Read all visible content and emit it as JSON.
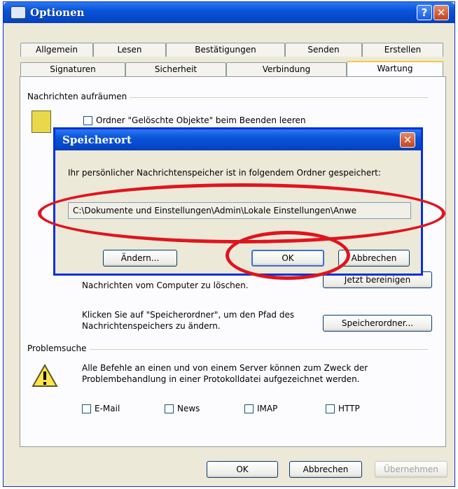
{
  "window": {
    "title": "Optionen",
    "help_glyph": "?",
    "close_glyph": "✕"
  },
  "tabs_row1": [
    "Allgemein",
    "Lesen",
    "Bestätigungen",
    "Senden",
    "Erstellen"
  ],
  "tabs_row2": [
    "Signaturen",
    "Sicherheit",
    "Verbindung",
    "Wartung"
  ],
  "active_tab": "Wartung",
  "cleanup": {
    "group_label": "Nachrichten aufräumen",
    "checkbox_empty_deleted": "Ordner \"Gelöschte Objekte\" beim Beenden leeren",
    "delete_text": "Nachrichten vom Computer zu löschen.",
    "delete_button": "Jetzt bereinigen",
    "store_text": "Klicken Sie auf \"Speicherordner\", um den Pfad des Nachrichtenspeichers zu ändern.",
    "store_button": "Speicherordner..."
  },
  "troubleshooting": {
    "group_label": "Problemsuche",
    "text": "Alle Befehle an einen und von einem Server können zum Zweck der Problembehandlung in einer Protokolldatei aufgezeichnet werden.",
    "checkboxes": [
      "E-Mail",
      "News",
      "IMAP",
      "HTTP"
    ]
  },
  "footer": {
    "ok": "OK",
    "cancel": "Abbrechen",
    "apply": "Übernehmen"
  },
  "dialog": {
    "title": "Speicherort",
    "close_glyph": "✕",
    "message": "Ihr persönlicher Nachrichtenspeicher ist in folgendem Ordner gespeichert:",
    "path": "C:\\Dokumente und Einstellungen\\Admin\\Lokale Einstellungen\\Anwe",
    "change_button": "Ändern...",
    "ok_button": "OK",
    "cancel_button": "Abbrechen"
  },
  "colors": {
    "titlebar": "#0a54d8",
    "highlight_ring": "#e0141e",
    "active_tab_accent": "#ffc83c"
  }
}
